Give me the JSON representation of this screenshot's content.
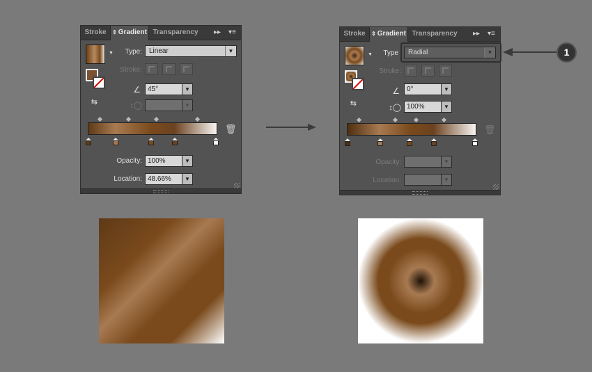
{
  "colors": {
    "bg": "#7a7a7a",
    "panel": "#535353",
    "dark_brown": "#5f3a17",
    "mid_brown": "#7a4a1c",
    "light_brown": "#a87a52",
    "callout": "#333333"
  },
  "left_panel": {
    "tabs": {
      "stroke": "Stroke",
      "gradient": "Gradient",
      "transparency": "Transparency"
    },
    "type_label": "Type:",
    "type_value": "Linear",
    "stroke_label": "Stroke:",
    "angle_value": "45°",
    "aspect_value": "",
    "opacity_label": "Opacity:",
    "opacity_value": "100%",
    "location_label": "Location:",
    "location_value": "48.66%",
    "icons": [
      "double-chevron-icon",
      "panel-menu-icon",
      "angle-icon",
      "aspect-ratio-icon",
      "reverse-gradient-icon",
      "trash-icon"
    ]
  },
  "right_panel": {
    "tabs": {
      "stroke": "Stroke",
      "gradient": "Gradient",
      "transparency": "Transparency"
    },
    "type_label": "Type",
    "type_value": "Radial",
    "stroke_label": "Stroke:",
    "angle_value": "0°",
    "aspect_value": "100%",
    "opacity_label": "Opacity:",
    "opacity_value": "",
    "location_label": "Location:",
    "location_value": ""
  },
  "callout": {
    "number": "1"
  },
  "previews": [
    {
      "name": "linear-preview",
      "gradient_type": "linear",
      "angle_deg": 45
    },
    {
      "name": "radial-preview",
      "gradient_type": "radial"
    }
  ]
}
